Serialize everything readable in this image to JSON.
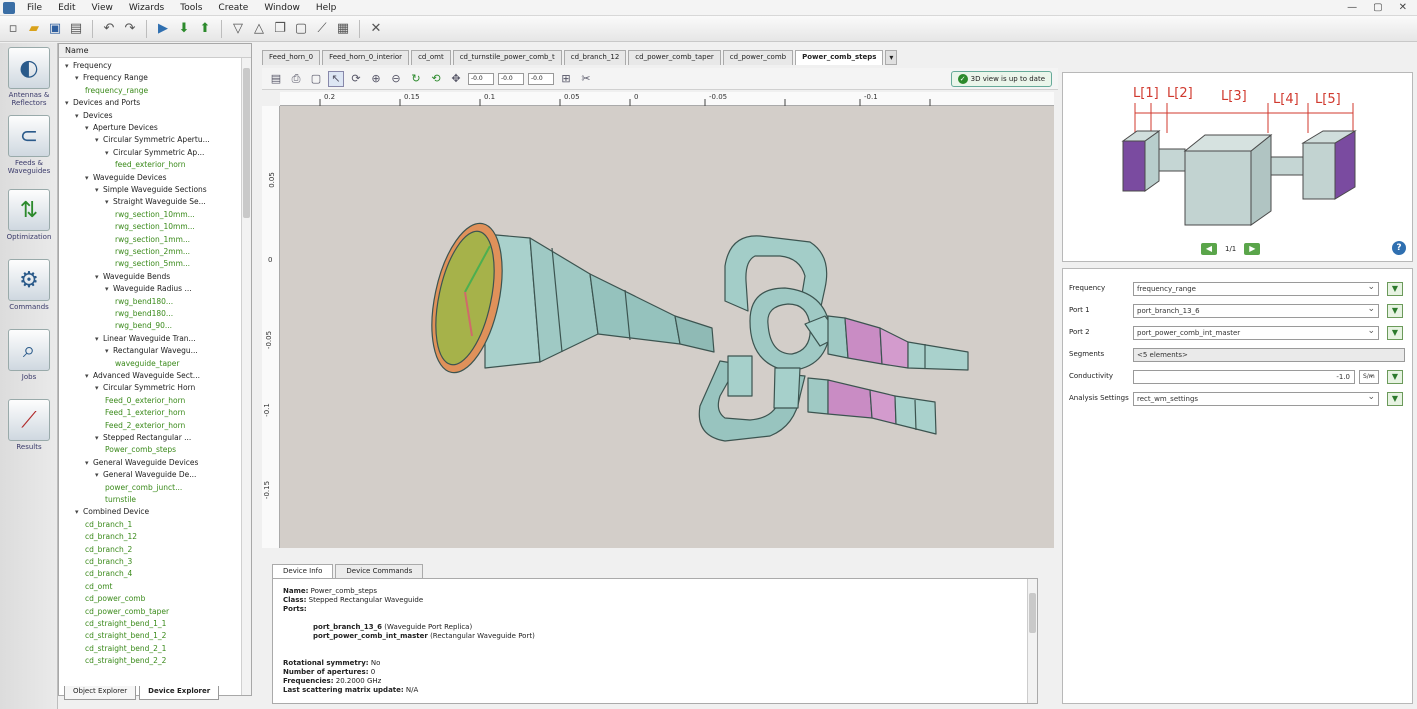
{
  "menu": [
    "File",
    "Edit",
    "View",
    "Wizards",
    "Tools",
    "Create",
    "Window",
    "Help"
  ],
  "window_controls": [
    "—",
    "▢",
    "✕"
  ],
  "toolbar_icons": [
    "new-file-icon",
    "open-folder-icon",
    "save-icon",
    "export-icon",
    "undo-icon",
    "redo-icon",
    "run-icon",
    "download-icon",
    "upload-icon",
    "filter-icon",
    "up-triangle-icon",
    "copy-icon",
    "paste-icon",
    "draw-line-icon",
    "table-icon",
    "cross-tool-icon"
  ],
  "sidebar": [
    {
      "label": "Antennas & Reflectors",
      "icon": "antenna-icon"
    },
    {
      "label": "Feeds & Waveguides",
      "icon": "waveguide-icon"
    },
    {
      "label": "Optimization",
      "icon": "optimization-icon"
    },
    {
      "label": "Commands",
      "icon": "commands-icon"
    },
    {
      "label": "Jobs",
      "icon": "jobs-icon"
    },
    {
      "label": "Results",
      "icon": "results-icon"
    }
  ],
  "tree": {
    "header": "Name",
    "rows": [
      {
        "label": "Frequency",
        "level": 0,
        "expanded": true
      },
      {
        "label": "Frequency Range",
        "level": 1,
        "expanded": true
      },
      {
        "label": "frequency_range",
        "level": 2,
        "leaf": true
      },
      {
        "label": "Devices and Ports",
        "level": 0,
        "expanded": true
      },
      {
        "label": "Devices",
        "level": 1,
        "expanded": true
      },
      {
        "label": "Aperture Devices",
        "level": 2,
        "expanded": true
      },
      {
        "label": "Circular Symmetric Apertu...",
        "level": 3,
        "expanded": true
      },
      {
        "label": "Circular Symmetric Ap...",
        "level": 4,
        "expanded": true
      },
      {
        "label": "feed_exterior_horn",
        "level": 5,
        "leaf": true
      },
      {
        "label": "Waveguide Devices",
        "level": 2,
        "expanded": true
      },
      {
        "label": "Simple Waveguide Sections",
        "level": 3,
        "expanded": true
      },
      {
        "label": "Straight Waveguide Se...",
        "level": 4,
        "expanded": true
      },
      {
        "label": "rwg_section_10mm...",
        "level": 5,
        "leaf": true
      },
      {
        "label": "rwg_section_10mm...",
        "level": 5,
        "leaf": true
      },
      {
        "label": "rwg_section_1mm...",
        "level": 5,
        "leaf": true
      },
      {
        "label": "rwg_section_2mm...",
        "level": 5,
        "leaf": true
      },
      {
        "label": "rwg_section_5mm...",
        "level": 5,
        "leaf": true
      },
      {
        "label": "Waveguide Bends",
        "level": 3,
        "expanded": true
      },
      {
        "label": "Waveguide Radius ...",
        "level": 4,
        "expanded": true
      },
      {
        "label": "rwg_bend180...",
        "level": 5,
        "leaf": true
      },
      {
        "label": "rwg_bend180...",
        "level": 5,
        "leaf": true
      },
      {
        "label": "rwg_bend_90...",
        "level": 5,
        "leaf": true
      },
      {
        "label": "Linear Waveguide Tran...",
        "level": 3,
        "expanded": true
      },
      {
        "label": "Rectangular Wavegu...",
        "level": 4,
        "expanded": true
      },
      {
        "label": "waveguide_taper",
        "level": 5,
        "leaf": true
      },
      {
        "label": "Advanced Waveguide Sect...",
        "level": 2,
        "expanded": true
      },
      {
        "label": "Circular Symmetric Horn",
        "level": 3,
        "expanded": true
      },
      {
        "label": "Feed_0_exterior_horn",
        "level": 4,
        "leaf": true
      },
      {
        "label": "Feed_1_exterior_horn",
        "level": 4,
        "leaf": true
      },
      {
        "label": "Feed_2_exterior_horn",
        "level": 4,
        "leaf": true
      },
      {
        "label": "Stepped Rectangular ...",
        "level": 3,
        "expanded": true
      },
      {
        "label": "Power_comb_steps",
        "level": 4,
        "leaf": true
      },
      {
        "label": "General Waveguide Devices",
        "level": 2,
        "expanded": true
      },
      {
        "label": "General Waveguide De...",
        "level": 3,
        "expanded": true
      },
      {
        "label": "power_comb_junct...",
        "level": 4,
        "leaf": true
      },
      {
        "label": "turnstile",
        "level": 4,
        "leaf": true
      },
      {
        "label": "Combined Device",
        "level": 1,
        "expanded": true
      },
      {
        "label": "cd_branch_1",
        "level": 2,
        "leaf": true
      },
      {
        "label": "cd_branch_12",
        "level": 2,
        "leaf": true
      },
      {
        "label": "cd_branch_2",
        "level": 2,
        "leaf": true
      },
      {
        "label": "cd_branch_3",
        "level": 2,
        "leaf": true
      },
      {
        "label": "cd_branch_4",
        "level": 2,
        "leaf": true
      },
      {
        "label": "cd_omt",
        "level": 2,
        "leaf": true
      },
      {
        "label": "cd_power_comb",
        "level": 2,
        "leaf": true
      },
      {
        "label": "cd_power_comb_taper",
        "level": 2,
        "leaf": true
      },
      {
        "label": "cd_straight_bend_1_1",
        "level": 2,
        "leaf": true
      },
      {
        "label": "cd_straight_bend_1_2",
        "level": 2,
        "leaf": true
      },
      {
        "label": "cd_straight_bend_2_1",
        "level": 2,
        "leaf": true
      },
      {
        "label": "cd_straight_bend_2_2",
        "level": 2,
        "leaf": true
      }
    ],
    "tabs": [
      "Object Explorer",
      "Device Explorer"
    ]
  },
  "doc_tabs": [
    "Feed_horn_0",
    "Feed_horn_0_interior",
    "cd_omt",
    "cd_turnstile_power_comb_t",
    "cd_branch_12",
    "cd_power_comb_taper",
    "cd_power_comb",
    "Power_comb_steps"
  ],
  "doc_tab_active": 7,
  "view_toolbar": {
    "status": "3D view is up to date",
    "fields": [
      "-0.0",
      "-0.0",
      "-0.0"
    ]
  },
  "ruler": {
    "top": [
      "0.2",
      "0.15",
      "0.1",
      "0.05",
      "0",
      "-0.05",
      "-0.1"
    ],
    "left": [
      "0.05",
      "0",
      "-0.05",
      "-0.1",
      "-0.15"
    ]
  },
  "info": {
    "tabs": [
      "Device Info",
      "Device Commands"
    ],
    "name_label": "Name:",
    "name_value": "Power_comb_steps",
    "class_label": "Class:",
    "class_value": "Stepped Rectangular Waveguide",
    "ports_label": "Ports:",
    "port1": "port_branch_13_6",
    "port1_desc": "(Waveguide Port Replica)",
    "port2": "port_power_comb_int_master",
    "port2_desc": "(Rectangular Waveguide Port)",
    "rot_label": "Rotational symmetry:",
    "rot_value": "No",
    "aper_label": "Number of apertures:",
    "aper_value": "0",
    "freq_label": "Frequencies:",
    "freq_value": "20.2000 GHz",
    "last_label": "Last scattering matrix update:",
    "last_value": "N/A"
  },
  "preview": {
    "labels": [
      "L[1]",
      "L[2]",
      "L[3]",
      "L[4]",
      "L[5]"
    ],
    "page": "1/1",
    "help": "?"
  },
  "props": [
    {
      "label": "Frequency",
      "value": "frequency_range",
      "type": "dropdown"
    },
    {
      "label": "Port 1",
      "value": "port_branch_13_6",
      "type": "dropdown"
    },
    {
      "label": "Port 2",
      "value": "port_power_comb_int_master",
      "type": "dropdown"
    },
    {
      "label": "Segments",
      "value": "<5 elements>",
      "type": "readonly"
    },
    {
      "label": "Conductivity",
      "value": "-1.0",
      "unit": "S/m",
      "type": "number"
    },
    {
      "label": "Analysis Settings",
      "value": "rect_wm_settings",
      "type": "dropdown"
    }
  ],
  "colors": {
    "viewport_bg": "#d3cec9",
    "model_body": "#9fc9c4",
    "model_edge": "#3c5450",
    "horn_rim": "#e0915a",
    "horn_aperture": "#a6b24a",
    "step_sections": "#c98cc4",
    "preview_port": "#7a4ba0",
    "ruler_red": "#d0392e",
    "accent_green": "#2c8a2c"
  }
}
